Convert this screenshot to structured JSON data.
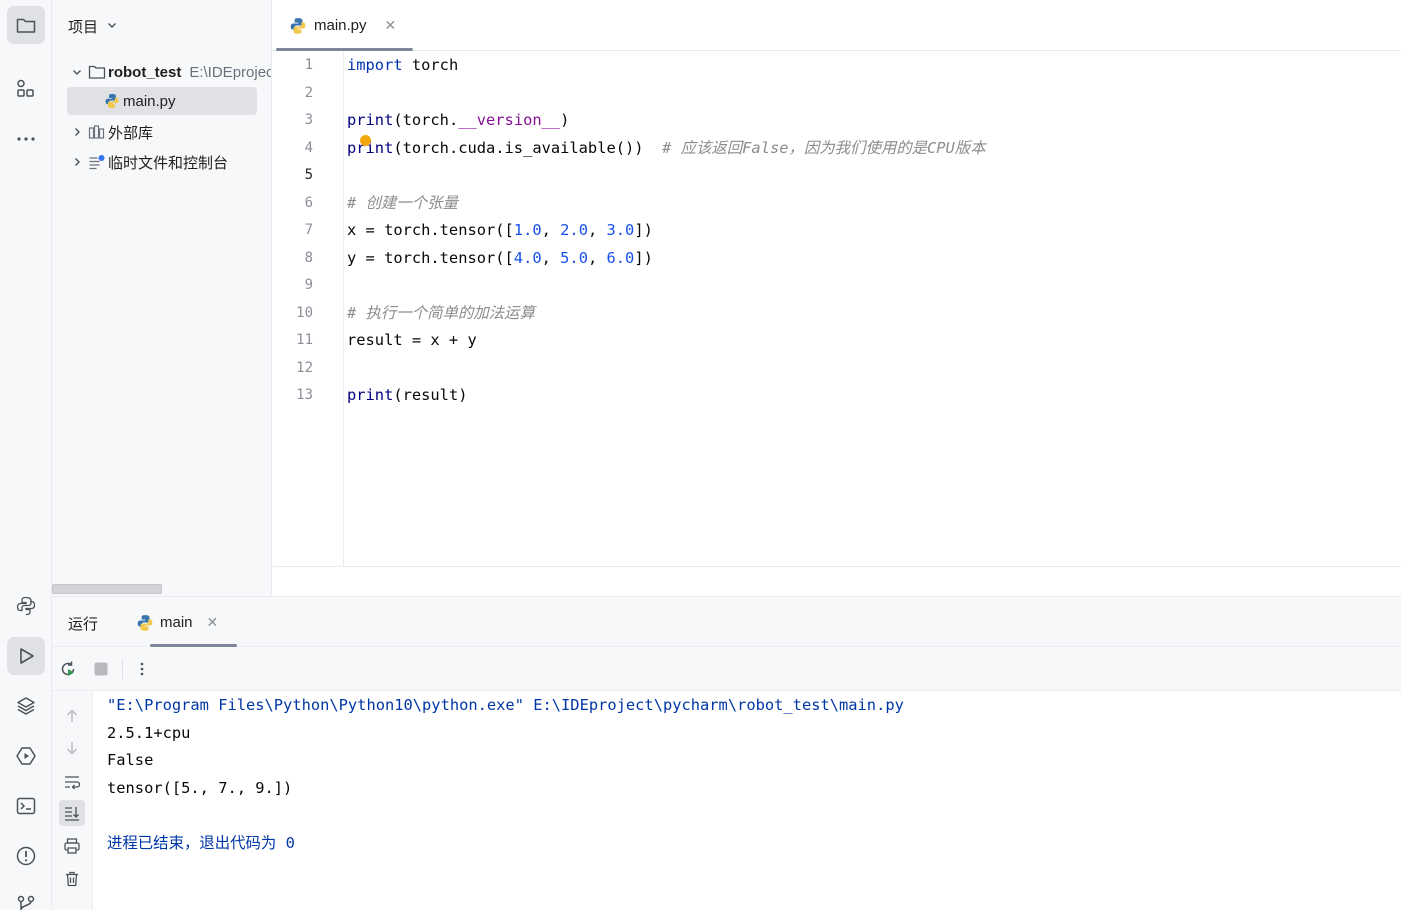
{
  "project_panel": {
    "title": "项目",
    "root": {
      "name": "robot_test",
      "path": "E:\\IDEproject\\pycharm\\robot_test"
    },
    "file": "main.py",
    "external_libs": "外部库",
    "scratches": "临时文件和控制台"
  },
  "editor": {
    "tab_label": "main.py",
    "current_line": 5,
    "line_numbers": [
      "1",
      "2",
      "3",
      "4",
      "5",
      "6",
      "7",
      "8",
      "9",
      "10",
      "11",
      "12",
      "13"
    ],
    "lines": [
      "import torch",
      "",
      "print(torch.__version__)",
      "print(torch.cuda.is_available())  # 应该返回False，因为我们使用的是CPU版本",
      "",
      "# 创建一个张量",
      "x = torch.tensor([1.0, 2.0, 3.0])",
      "y = torch.tensor([4.0, 5.0, 6.0])",
      "",
      "# 执行一个简单的加法运算",
      "result = x + y",
      "",
      "print(result)"
    ]
  },
  "run_panel": {
    "title": "运行",
    "tab_label": "main",
    "output": [
      "\"E:\\Program Files\\Python\\Python10\\python.exe\" E:\\IDEproject\\pycharm\\robot_test\\main.py",
      "2.5.1+cpu",
      "False",
      "tensor([5., 7., 9.])",
      "",
      "进程已结束，退出代码为 0"
    ]
  },
  "icons": {
    "toolstrip": [
      "folder-icon",
      "structure-icon",
      "more-icon",
      "python-console-icon",
      "run-icon",
      "layers-icon",
      "services-icon",
      "terminal-icon",
      "problems-icon",
      "git-icon"
    ]
  },
  "colors": {
    "keyword": "#0033b3",
    "number": "#1750eb",
    "dunder": "#871094",
    "comment": "#8c8c8c",
    "panel_bg": "#f7f8fa",
    "selected_bg": "#dfe1e5"
  }
}
